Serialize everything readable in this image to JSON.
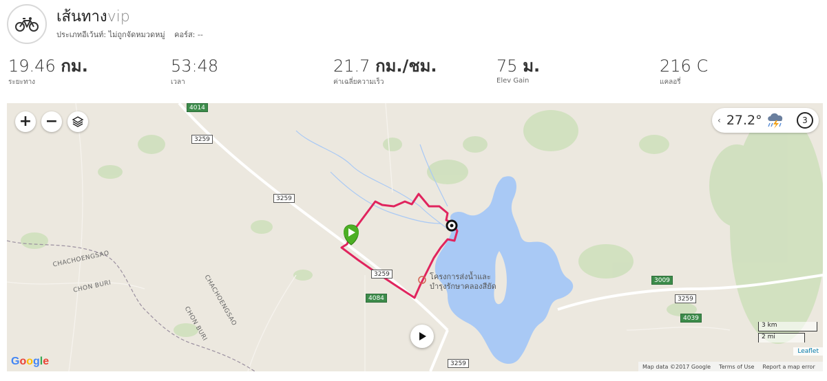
{
  "activity": {
    "icon": "bicycle-icon",
    "title_main": "เส้นทาง",
    "title_suffix": "vip",
    "event_type": "ประเภทอีเว้นท์: ไม่ถูกจัดหมวดหมู่",
    "course": "คอร์ส: --"
  },
  "stats": [
    {
      "value": "19.46",
      "unit": "กม.",
      "label": "ระยะทาง"
    },
    {
      "value": "53:48",
      "unit": "",
      "label": "เวลา"
    },
    {
      "value": "21.7",
      "unit": "กม./ชม.",
      "label": "ค่าเฉลี่ยความเร็ว"
    },
    {
      "value": "75",
      "unit": "ม.",
      "label": "Elev Gain"
    },
    {
      "value": "216 C",
      "unit": "",
      "label": "แคลอรี่"
    }
  ],
  "map": {
    "zoom_in": "+",
    "zoom_out": "−",
    "layers_icon": "layers-icon",
    "weather": {
      "temperature": "27.2°",
      "icon": "storm-cloud-icon",
      "timer_value": "3"
    },
    "roads": [
      "4014",
      "3259",
      "3259",
      "3259",
      "4084",
      "3009",
      "3259",
      "4039",
      "3259"
    ],
    "region_labels": [
      "CHACHOENGSAO",
      "CHON BURI",
      "CHACHOENGSAO",
      "CHON BURI"
    ],
    "poi": "โครงการส่งน้ำและ\nบำรุงรักษาคลองสียัด",
    "scale": {
      "km": "3 km",
      "mi": "2 mi"
    },
    "leaflet": "Leaflet",
    "google": "Google",
    "footer": {
      "map_data": "Map data ©2017 Google",
      "terms": "Terms of Use",
      "report": "Report a map error"
    },
    "colors": {
      "route": "#e0245e",
      "water": "#a9c9f5",
      "start": "#4caf24",
      "land": "#ece8df"
    }
  }
}
